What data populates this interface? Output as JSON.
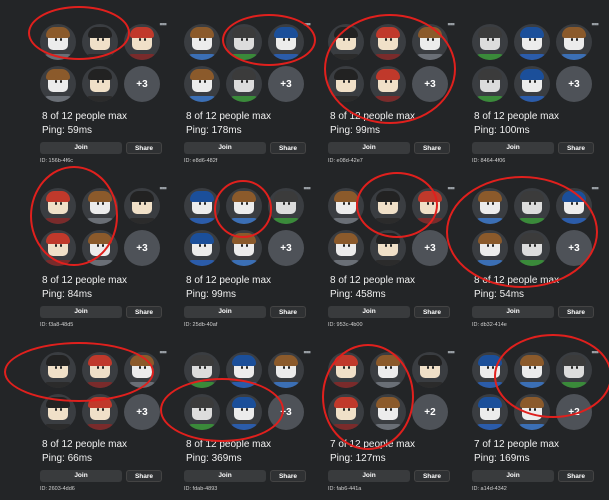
{
  "colors": {
    "background": "#232527",
    "button": "#393b3d",
    "text": "#f0f0f0",
    "annotation": "#e0201d"
  },
  "more_icon": "ellipsis-icon",
  "labels": {
    "join": "Join",
    "share": "Share"
  },
  "servers": [
    {
      "players": "8 of 12 people max",
      "ping": "Ping: 59ms",
      "id": "ID: 156b-4f6c",
      "more": "+3"
    },
    {
      "players": "8 of 12 people max",
      "ping": "Ping: 178ms",
      "id": "ID: e8d6-482f",
      "more": "+3"
    },
    {
      "players": "8 of 12 people max",
      "ping": "Ping: 99ms",
      "id": "ID: e08d-42e7",
      "more": "+3"
    },
    {
      "players": "8 of 12 people max",
      "ping": "Ping: 100ms",
      "id": "ID: 8464-4f06",
      "more": "+3"
    },
    {
      "players": "8 of 12 people max",
      "ping": "Ping: 84ms",
      "id": "ID: f3a8-48d5",
      "more": "+3"
    },
    {
      "players": "8 of 12 people max",
      "ping": "Ping: 99ms",
      "id": "ID: 25db-40af",
      "more": "+3"
    },
    {
      "players": "8 of 12 people max",
      "ping": "Ping: 458ms",
      "id": "ID: 953c-4b00",
      "more": "+3"
    },
    {
      "players": "8 of 12 people max",
      "ping": "Ping: 54ms",
      "id": "ID: db32-414e",
      "more": "+3"
    },
    {
      "players": "8 of 12 people max",
      "ping": "Ping: 66ms",
      "id": "ID: 2603-4dd6",
      "more": "+3"
    },
    {
      "players": "8 of 12 people max",
      "ping": "Ping: 369ms",
      "id": "ID: fdab-4893",
      "more": "+3"
    },
    {
      "players": "7 of 12 people max",
      "ping": "Ping: 127ms",
      "id": "ID: fab6-441a",
      "more": "+2"
    },
    {
      "players": "7 of 12 people max",
      "ping": "Ping: 169ms",
      "id": "ID: a14d-4342",
      "more": "+2"
    }
  ]
}
